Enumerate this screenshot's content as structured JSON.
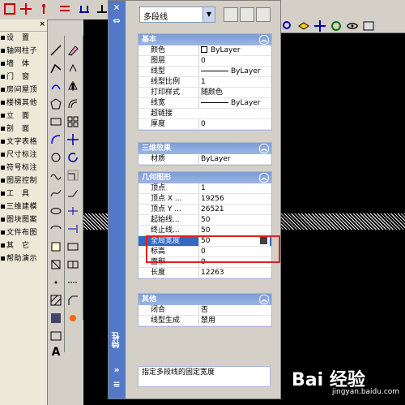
{
  "left_menu": {
    "items": [
      "设　置",
      "轴网柱子",
      "墙　体",
      "门　窗",
      "房间屋顶",
      "楼梯其他",
      "立　面",
      "剖　面",
      "文字表格",
      "尺寸标注",
      "符号标注",
      "图层控制",
      "工　具",
      "三维建模",
      "图块图案",
      "文件布图",
      "其　它",
      "帮助演示"
    ]
  },
  "properties": {
    "palette_title": "特性",
    "object_type": "多段线",
    "sections": [
      {
        "title": "基本",
        "rows": [
          {
            "key": "颜色",
            "value": "ByLayer",
            "swatch": true
          },
          {
            "key": "图层",
            "value": "0"
          },
          {
            "key": "线型",
            "value": "ByLayer",
            "line": true
          },
          {
            "key": "线型比例",
            "value": "1"
          },
          {
            "key": "打印样式",
            "value": "随颜色"
          },
          {
            "key": "线宽",
            "value": "ByLayer",
            "line": true
          },
          {
            "key": "超链接",
            "value": ""
          },
          {
            "key": "厚度",
            "value": "0"
          }
        ]
      },
      {
        "title": "三维效果",
        "rows": [
          {
            "key": "材质",
            "value": "ByLayer"
          }
        ]
      },
      {
        "title": "几何图形",
        "rows": [
          {
            "key": "顶点",
            "value": "1"
          },
          {
            "key": "顶点 X ...",
            "value": "19256"
          },
          {
            "key": "顶点 Y ...",
            "value": "26521"
          },
          {
            "key": "起始线...",
            "value": "50"
          },
          {
            "key": "终止线...",
            "value": "50"
          },
          {
            "key": "全局宽度",
            "value": "50",
            "selected": true
          },
          {
            "key": "标高",
            "value": "0"
          },
          {
            "key": "面积",
            "value": "0"
          },
          {
            "key": "长度",
            "value": "12263"
          }
        ]
      },
      {
        "title": "其他",
        "rows": [
          {
            "key": "闭合",
            "value": "否"
          },
          {
            "key": "线型生成",
            "value": "禁用"
          }
        ]
      }
    ],
    "description": "指定多段线的固定宽度"
  },
  "watermark": {
    "text": "Bai 经验",
    "url": "jingyan.baidu.com"
  },
  "colors": {
    "title_blue": "#5478c8",
    "section_head": "#7c9bd6",
    "selected_row": "#316ac5",
    "highlight_red": "#e02020"
  }
}
